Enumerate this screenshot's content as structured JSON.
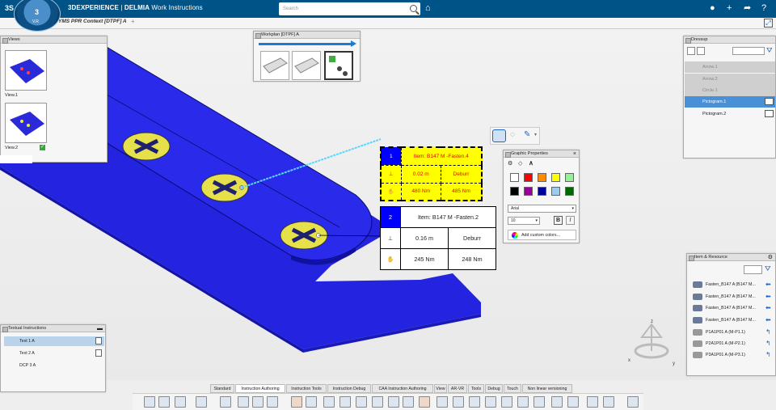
{
  "topbar": {
    "ds_logo": "3S",
    "compass_label": "3",
    "compass_version": "V.R",
    "brand_bold": "3DEXPERIENCE",
    "brand_sep": " | ",
    "brand_app": "DELMIA",
    "brand_module": " Work Instructions",
    "search_placeholder": "Search"
  },
  "tab": {
    "title": "YMS PPR Context [DTPF] A",
    "add": "+"
  },
  "views_panel": {
    "title": "Views",
    "items": [
      {
        "label": "View.1"
      },
      {
        "label": "View.2"
      }
    ]
  },
  "workplan_panel": {
    "title": "Workplan [DTPF] A"
  },
  "dressup_panel": {
    "title": "Dressup",
    "items": [
      {
        "label": "Arrow.1",
        "state": "dim"
      },
      {
        "label": "Arrow.2",
        "state": "dim"
      },
      {
        "label": "Circle.1",
        "state": "dim"
      },
      {
        "label": "Pictogram.1",
        "state": "selected"
      },
      {
        "label": "Pictogram.2",
        "state": "normal"
      }
    ]
  },
  "graphic_properties": {
    "title": "Graphic Properties",
    "colors": [
      "#ffffff",
      "#ff0000",
      "#ff8c00",
      "#ffff00",
      "#99ee99",
      "#000000",
      "#990099",
      "#000099",
      "#99ccee",
      "#006600"
    ],
    "font_name": "Arial",
    "font_size": "10",
    "bold": "B",
    "italic": "I",
    "add_colors": "Add custom colors..."
  },
  "annotation1": {
    "number": "1",
    "item": "Item: B147 M -Fasten.4",
    "distance": "0.02 m",
    "operation": "Deburr",
    "torque1": "480 Nm",
    "torque2": "485 Nm"
  },
  "annotation2": {
    "number": "2",
    "item": "Item: B147 M -Fasten.2",
    "distance": "0.16 m",
    "operation": "Deburr",
    "torque1": "245 Nm",
    "torque2": "248 Nm"
  },
  "item_resource_panel": {
    "title": "Item & Resource",
    "items": [
      {
        "label": "Fasten_B147 A (B147 M..."
      },
      {
        "label": "Fasten_B147 A (B147 M..."
      },
      {
        "label": "Fasten_B147 A (B147 M..."
      },
      {
        "label": "Fasten_B147 A (B147 M..."
      },
      {
        "label": "P1A1P01 A (M-P1.1)"
      },
      {
        "label": "P2A1P01 A (M-P2.1)"
      },
      {
        "label": "P3A1P01 A (M-P3.1)"
      }
    ]
  },
  "textual_panel": {
    "title": "Textual Instructions",
    "items": [
      {
        "label": "Text 1 A"
      },
      {
        "label": "Text 2 A"
      },
      {
        "label": "DCP 3 A"
      }
    ]
  },
  "bottom_tabs": [
    "Standard",
    "Instruction Authoring",
    "Instruction Tools",
    "Instruction Debug",
    "CAA Instruction Authoring",
    "View",
    "AR-VR",
    "Tools",
    "Debug",
    "Touch",
    "Non linear versioning"
  ],
  "compass_axes": {
    "x": "x",
    "y": "y",
    "z": "z"
  }
}
